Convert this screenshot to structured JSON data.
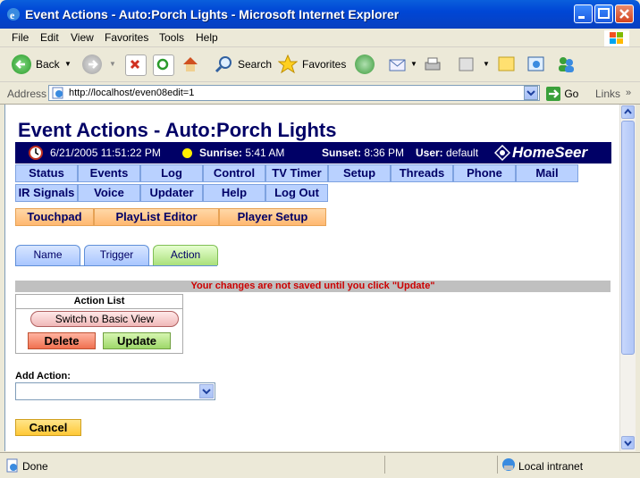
{
  "window": {
    "title": "Event Actions - Auto:Porch Lights - Microsoft Internet Explorer"
  },
  "menu": [
    "File",
    "Edit",
    "View",
    "Favorites",
    "Tools",
    "Help"
  ],
  "toolbar": {
    "back_label": "Back",
    "search_label": "Search",
    "favorites_label": "Favorites"
  },
  "address": {
    "label": "Address",
    "value": "http://localhost/even08edit=1",
    "go_label": "Go",
    "links_label": "Links"
  },
  "page": {
    "title": "Event Actions - Auto:Porch Lights",
    "info": {
      "datetime": "6/21/2005 11:51:22 PM",
      "sunrise_label": "Sunrise:",
      "sunrise_value": "5:41 AM",
      "sunset_label": "Sunset:",
      "sunset_value": "8:36 PM",
      "user_label": "User:",
      "user_value": "default",
      "logo": "HomeSeer"
    },
    "nav_row1": [
      "Status",
      "Events",
      "Log",
      "Control",
      "TV Timer",
      "Setup",
      "Threads",
      "Phone",
      "Mail"
    ],
    "nav_row2": [
      "IR Signals",
      "Voice",
      "Updater",
      "Help",
      "Log Out"
    ],
    "nav_row3": [
      "Touchpad",
      "PlayList Editor",
      "Player Setup"
    ],
    "tabs": [
      "Name",
      "Trigger",
      "Action"
    ],
    "active_tab": "Action",
    "warning": "Your changes are not saved until you click \"Update\"",
    "action_list": {
      "header": "Action List",
      "basic_view_label": "Switch to Basic View",
      "delete_label": "Delete",
      "update_label": "Update"
    },
    "add_action": {
      "label": "Add Action:",
      "value": ""
    },
    "cancel_label": "Cancel"
  },
  "status": {
    "text": "Done",
    "zone": "Local intranet"
  },
  "colors": {
    "accent": "#000066",
    "warning": "#cc0000"
  }
}
